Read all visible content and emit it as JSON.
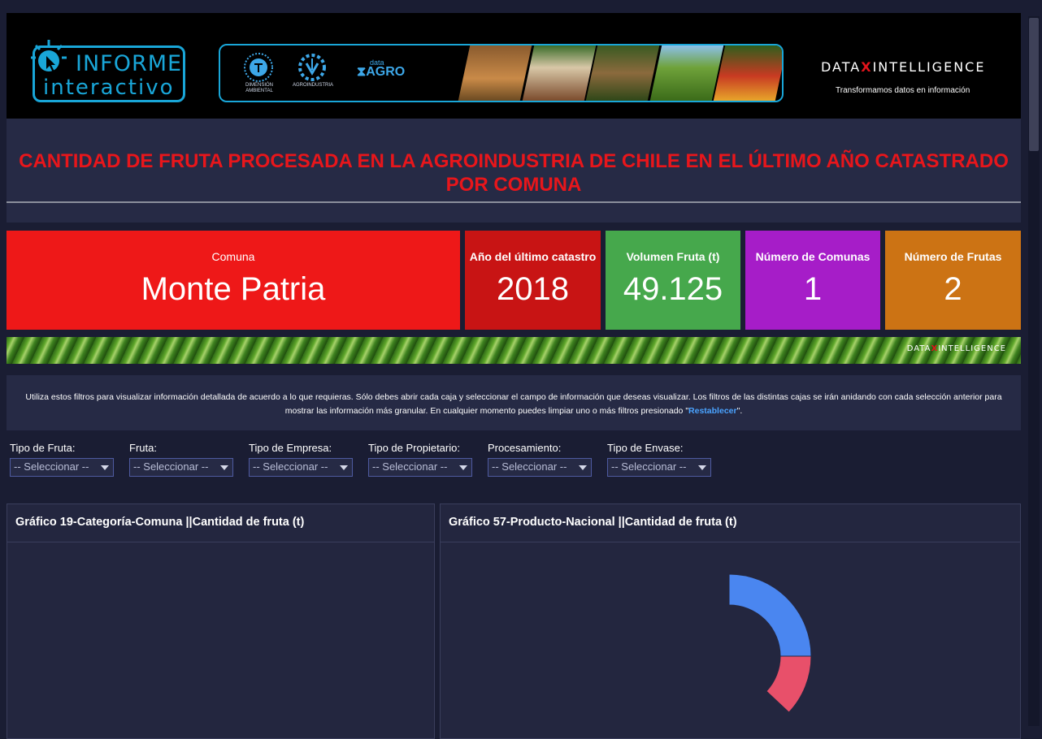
{
  "header": {
    "logo_line1": "INFORME",
    "logo_line2": "interactivo",
    "seal1_caption": "DIMENSIÓN AMBIENTAL",
    "seal2_caption": "AGROINDUSTRIA",
    "dataagro_small": "data",
    "dataagro_big": "AGRO",
    "di_left": "DATA",
    "di_x": "X",
    "di_right": "INTELLIGENCE",
    "di_tagline": "Transformamos datos en información"
  },
  "title": "CANTIDAD DE FRUTA PROCESADA EN LA AGROINDUSTRIA DE CHILE EN EL ÚLTIMO AÑO CATASTRADO POR COMUNA",
  "kpis": [
    {
      "label": "Comuna",
      "value": "Monte Patria",
      "color": "#ee1818"
    },
    {
      "label": "Año del último catastro",
      "value": "2018",
      "color": "#c81414"
    },
    {
      "label": "Volumen Fruta (t)",
      "value": "49.125",
      "color": "#46a84c"
    },
    {
      "label": "Número de Comunas",
      "value": "1",
      "color": "#a61dc8"
    },
    {
      "label": "Número de Frutas",
      "value": "2",
      "color": "#cc7314"
    }
  ],
  "strip_logo": {
    "left": "DATA",
    "x": "X",
    "right": "INTELLIGENCE"
  },
  "info": {
    "text_before": "Utiliza estos filtros para visualizar información detallada de acuerdo a lo que requieras. Sólo debes abrir cada caja y seleccionar el campo de información que deseas visualizar. Los filtros de las distintas cajas se irán anidando con cada selección anterior para mostrar las información más granular. En cualquier momento puedes limpiar uno o más filtros presionado \"",
    "link": "Restablecer",
    "text_after": "\"."
  },
  "filters": [
    {
      "label": "Tipo de Fruta:",
      "value": "-- Seleccionar --"
    },
    {
      "label": "Fruta:",
      "value": "-- Seleccionar --"
    },
    {
      "label": "Tipo de Empresa:",
      "value": "-- Seleccionar --"
    },
    {
      "label": "Tipo de Propietario:",
      "value": "-- Seleccionar --"
    },
    {
      "label": "Procesamiento:",
      "value": "-- Seleccionar --"
    },
    {
      "label": "Tipo de Envase:",
      "value": "-- Seleccionar --"
    }
  ],
  "panels": [
    {
      "title": "Gráfico 19-Categoría-Comuna ||Cantidad de fruta (t)"
    },
    {
      "title": "Gráfico 57-Producto-Nacional ||Cantidad de fruta (t)"
    }
  ],
  "chart_data": {
    "type": "pie",
    "title": "Gráfico 57-Producto-Nacional ||Cantidad de fruta (t)",
    "series": [
      {
        "value": 0.25,
        "color": "#4a86f0"
      },
      {
        "value": 0.12,
        "color": "#e8506a"
      }
    ]
  }
}
